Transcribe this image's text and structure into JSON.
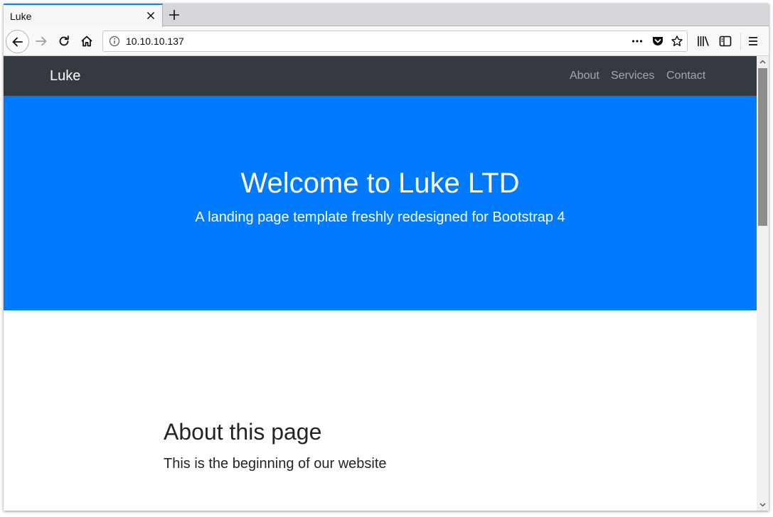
{
  "tab": {
    "title": "Luke"
  },
  "toolbar": {
    "url": "10.10.10.137",
    "icons": [
      "back-icon",
      "forward-icon",
      "reload-icon",
      "home-icon",
      "page-actions-icon",
      "pocket-icon",
      "bookmark-star-icon",
      "library-icon",
      "sidebar-icon",
      "menu-icon"
    ]
  },
  "site": {
    "brand": "Luke",
    "nav": [
      {
        "label": "About"
      },
      {
        "label": "Services"
      },
      {
        "label": "Contact"
      }
    ],
    "hero": {
      "title": "Welcome to Luke LTD",
      "subtitle": "A landing page template freshly redesigned for Bootstrap 4"
    },
    "about": {
      "title": "About this page",
      "text": "This is the beginning of our website"
    }
  },
  "colors": {
    "navbar": "#343a40",
    "hero": "#007bff",
    "tab_accent": "#0a84ff"
  }
}
